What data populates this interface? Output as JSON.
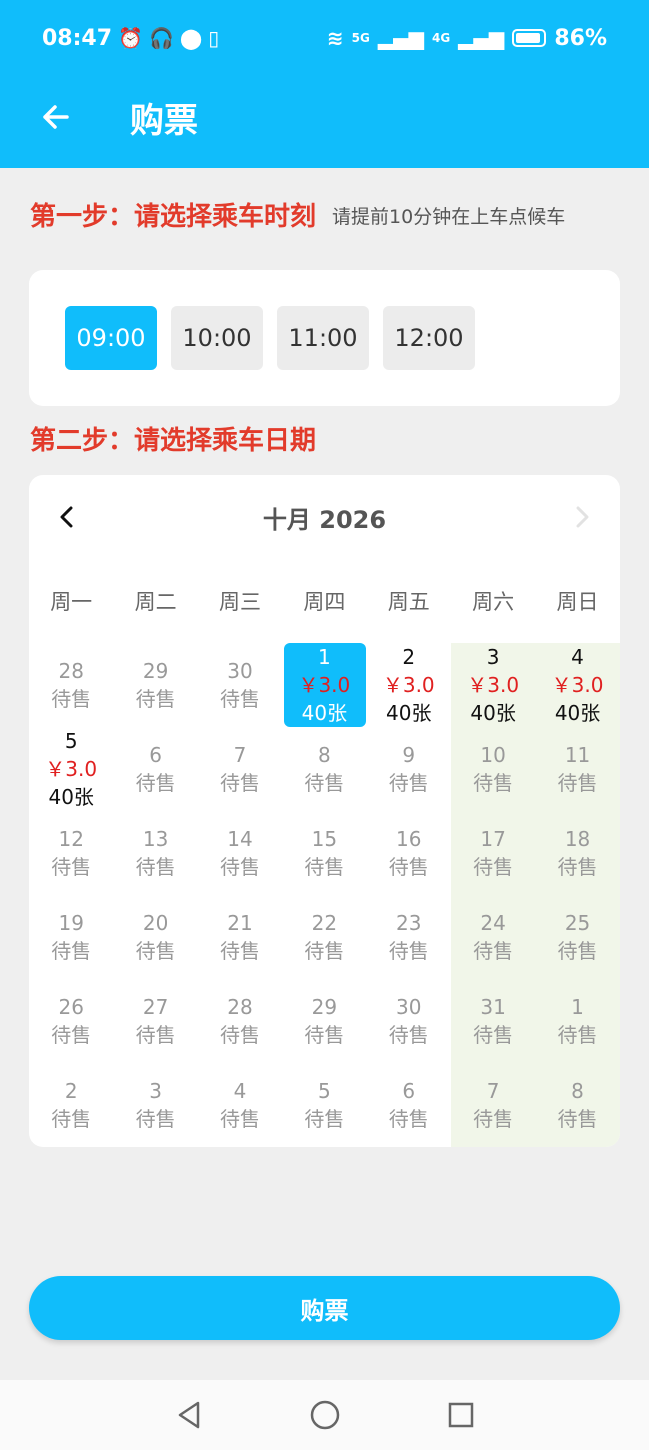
{
  "status_bar": {
    "time": "08:47",
    "battery": "86%",
    "network_5g": "5G",
    "network_4g": "4G"
  },
  "header": {
    "title": "购票",
    "back_icon": "arrow-left-icon"
  },
  "step1": {
    "title": "第一步：请选择乘车时刻",
    "hint": "请提前10分钟在上车点候车"
  },
  "times": [
    {
      "label": "09:00",
      "selected": true
    },
    {
      "label": "10:00",
      "selected": false
    },
    {
      "label": "11:00",
      "selected": false
    },
    {
      "label": "12:00",
      "selected": false
    }
  ],
  "step2": {
    "title": "第二步：请选择乘车日期"
  },
  "calendar": {
    "title": "十月 2026",
    "prev_icon": "chevron-left-icon",
    "next_icon": "chevron-right-icon",
    "weekdays": [
      "周一",
      "周二",
      "周三",
      "周四",
      "周五",
      "周六",
      "周日"
    ],
    "days": [
      {
        "num": "28",
        "status": "待售"
      },
      {
        "num": "29",
        "status": "待售"
      },
      {
        "num": "30",
        "status": "待售"
      },
      {
        "num": "1",
        "price": "￥3.0",
        "qty": "40张",
        "selected": true
      },
      {
        "num": "2",
        "price": "￥3.0",
        "qty": "40张"
      },
      {
        "num": "3",
        "price": "￥3.0",
        "qty": "40张"
      },
      {
        "num": "4",
        "price": "￥3.0",
        "qty": "40张"
      },
      {
        "num": "5",
        "price": "￥3.0",
        "qty": "40张"
      },
      {
        "num": "6",
        "status": "待售"
      },
      {
        "num": "7",
        "status": "待售"
      },
      {
        "num": "8",
        "status": "待售"
      },
      {
        "num": "9",
        "status": "待售"
      },
      {
        "num": "10",
        "status": "待售"
      },
      {
        "num": "11",
        "status": "待售"
      },
      {
        "num": "12",
        "status": "待售"
      },
      {
        "num": "13",
        "status": "待售"
      },
      {
        "num": "14",
        "status": "待售"
      },
      {
        "num": "15",
        "status": "待售"
      },
      {
        "num": "16",
        "status": "待售"
      },
      {
        "num": "17",
        "status": "待售"
      },
      {
        "num": "18",
        "status": "待售"
      },
      {
        "num": "19",
        "status": "待售"
      },
      {
        "num": "20",
        "status": "待售"
      },
      {
        "num": "21",
        "status": "待售"
      },
      {
        "num": "22",
        "status": "待售"
      },
      {
        "num": "23",
        "status": "待售"
      },
      {
        "num": "24",
        "status": "待售"
      },
      {
        "num": "25",
        "status": "待售"
      },
      {
        "num": "26",
        "status": "待售"
      },
      {
        "num": "27",
        "status": "待售"
      },
      {
        "num": "28",
        "status": "待售"
      },
      {
        "num": "29",
        "status": "待售"
      },
      {
        "num": "30",
        "status": "待售"
      },
      {
        "num": "31",
        "status": "待售"
      },
      {
        "num": "1",
        "status": "待售"
      },
      {
        "num": "2",
        "status": "待售"
      },
      {
        "num": "3",
        "status": "待售"
      },
      {
        "num": "4",
        "status": "待售"
      },
      {
        "num": "5",
        "status": "待售"
      },
      {
        "num": "6",
        "status": "待售"
      },
      {
        "num": "7",
        "status": "待售"
      },
      {
        "num": "8",
        "status": "待售"
      }
    ]
  },
  "buy_button": "购票",
  "colors": {
    "accent": "#10bdfb",
    "step_red": "#e23b2b",
    "price_red": "#e02020",
    "weekend_bg": "#f1f6e9"
  }
}
